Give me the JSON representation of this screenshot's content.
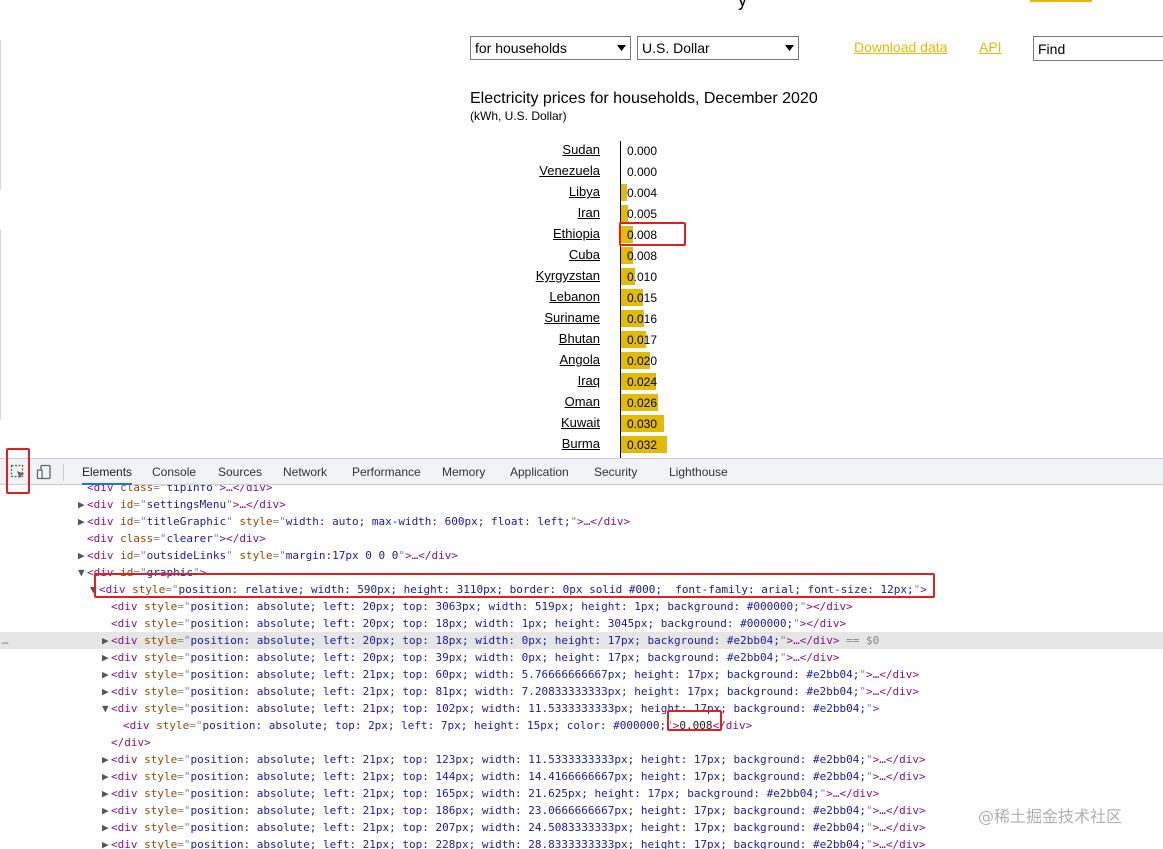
{
  "header": {
    "title_fragment": "y",
    "type_select": "for households",
    "currency_select": "U.S. Dollar",
    "download_link": "Download data",
    "api_link": "API",
    "find_value": "Find"
  },
  "colors": {
    "bar": "#e2bb04",
    "link": "#e2bb04",
    "highlight": "#e02020",
    "devtools_active": "#1a73e8"
  },
  "chart_data": {
    "type": "bar",
    "orientation": "horizontal",
    "title": "Electricity prices for households, December 2020",
    "subtitle": "(kWh, U.S. Dollar)",
    "categories": [
      "Sudan",
      "Venezuela",
      "Libya",
      "Iran",
      "Ethiopia",
      "Cuba",
      "Kyrgyzstan",
      "Lebanon",
      "Suriname",
      "Bhutan",
      "Angola",
      "Iraq",
      "Oman",
      "Kuwait",
      "Burma"
    ],
    "values": [
      0.0,
      0.0,
      0.004,
      0.005,
      0.008,
      0.008,
      0.01,
      0.015,
      0.016,
      0.017,
      0.02,
      0.024,
      0.026,
      0.03,
      0.032
    ],
    "labels": [
      "0.000",
      "0.000",
      "0.004",
      "0.005",
      "0.008",
      "0.008",
      "0.010",
      "0.015",
      "0.016",
      "0.017",
      "0.020",
      "0.024",
      "0.026",
      "0.030",
      "0.032"
    ],
    "highlighted": "Ethiopia"
  },
  "devtools": {
    "tabs": [
      "Elements",
      "Console",
      "Sources",
      "Network",
      "Performance",
      "Memory",
      "Application",
      "Security",
      "Lighthouse"
    ],
    "active_tab": "Elements",
    "selected_suffix": "== $0",
    "lines": [
      {
        "i": 1,
        "tri": "",
        "tag": "div",
        "attrs": [
          [
            "class",
            "tipInfo"
          ]
        ],
        "tail": ">…</div>"
      },
      {
        "i": 1,
        "tri": "▶",
        "tag": "div",
        "attrs": [
          [
            "id",
            "settingsMenu"
          ]
        ],
        "tail": ">…</div>"
      },
      {
        "i": 1,
        "tri": "▶",
        "tag": "div",
        "attrs": [
          [
            "id",
            "titleGraphic"
          ],
          [
            "style",
            "width: auto; max-width: 600px; float: left;"
          ]
        ],
        "tail": ">…</div>"
      },
      {
        "i": 1,
        "tri": "",
        "tag": "div",
        "attrs": [
          [
            "class",
            "clearer"
          ]
        ],
        "tail": "></div>"
      },
      {
        "i": 1,
        "tri": "▶",
        "tag": "div",
        "attrs": [
          [
            "id",
            "outsideLinks"
          ],
          [
            "style",
            "margin:17px 0 0 0"
          ]
        ],
        "tail": ">…</div>"
      },
      {
        "i": 1,
        "tri": "▼",
        "tag": "div",
        "attrs": [
          [
            "id",
            "graphic"
          ]
        ],
        "tail": ">"
      },
      {
        "i": 2,
        "tri": "▼",
        "tag": "div",
        "attrs": [
          [
            "style",
            "position: relative; width: 590px; height: 3110px; border: 0px solid #000;  font-family: arial; font-size: 12px;"
          ]
        ],
        "tail": ">"
      },
      {
        "i": 3,
        "tri": "",
        "tag": "div",
        "attrs": [
          [
            "style",
            "position: absolute; left: 20px; top: 3063px; width: 519px; height: 1px; background: #000000;"
          ]
        ],
        "tail": "></div>"
      },
      {
        "i": 3,
        "tri": "",
        "tag": "div",
        "attrs": [
          [
            "style",
            "position: absolute; left: 20px; top: 18px; width: 1px; height: 3045px; background: #000000;"
          ]
        ],
        "tail": "></div>"
      },
      {
        "i": 3,
        "tri": "▶",
        "tag": "div",
        "attrs": [
          [
            "style",
            "position: absolute; left: 20px; top: 18px; width: 0px; height: 17px; background: #e2bb04;"
          ]
        ],
        "tail": ">…</div>",
        "sel": true
      },
      {
        "i": 3,
        "tri": "▶",
        "tag": "div",
        "attrs": [
          [
            "style",
            "position: absolute; left: 20px; top: 39px; width: 0px; height: 17px; background: #e2bb04;"
          ]
        ],
        "tail": ">…</div>"
      },
      {
        "i": 3,
        "tri": "▶",
        "tag": "div",
        "attrs": [
          [
            "style",
            "position: absolute; left: 21px; top: 60px; width: 5.76666666667px; height: 17px; background: #e2bb04;"
          ]
        ],
        "tail": ">…</div>"
      },
      {
        "i": 3,
        "tri": "▶",
        "tag": "div",
        "attrs": [
          [
            "style",
            "position: absolute; left: 21px; top: 81px; width: 7.20833333333px; height: 17px; background: #e2bb04;"
          ]
        ],
        "tail": ">…</div>"
      },
      {
        "i": 3,
        "tri": "▼",
        "tag": "div",
        "attrs": [
          [
            "style",
            "position: absolute; left: 21px; top: 102px; width: 11.5333333333px; height: 17px; background: #e2bb04;"
          ]
        ],
        "tail": ">"
      },
      {
        "i": 4,
        "tri": "",
        "tag": "div",
        "attrs": [
          [
            "style",
            "position: absolute; top: 2px; left: 7px; height: 15px; color: #000000;"
          ]
        ],
        "tail": ">",
        "text": "0.008",
        "close": "</div>"
      },
      {
        "i": 3,
        "tri": "",
        "tag": "",
        "attrs": [],
        "tail": "",
        "close": "</div>"
      },
      {
        "i": 3,
        "tri": "▶",
        "tag": "div",
        "attrs": [
          [
            "style",
            "position: absolute; left: 21px; top: 123px; width: 11.5333333333px; height: 17px; background: #e2bb04;"
          ]
        ],
        "tail": ">…</div>"
      },
      {
        "i": 3,
        "tri": "▶",
        "tag": "div",
        "attrs": [
          [
            "style",
            "position: absolute; left: 21px; top: 144px; width: 14.4166666667px; height: 17px; background: #e2bb04;"
          ]
        ],
        "tail": ">…</div>"
      },
      {
        "i": 3,
        "tri": "▶",
        "tag": "div",
        "attrs": [
          [
            "style",
            "position: absolute; left: 21px; top: 165px; width: 21.625px; height: 17px; background: #e2bb04;"
          ]
        ],
        "tail": ">…</div>"
      },
      {
        "i": 3,
        "tri": "▶",
        "tag": "div",
        "attrs": [
          [
            "style",
            "position: absolute; left: 21px; top: 186px; width: 23.0666666667px; height: 17px; background: #e2bb04;"
          ]
        ],
        "tail": ">…</div>"
      },
      {
        "i": 3,
        "tri": "▶",
        "tag": "div",
        "attrs": [
          [
            "style",
            "position: absolute; left: 21px; top: 207px; width: 24.5083333333px; height: 17px; background: #e2bb04;"
          ]
        ],
        "tail": ">…</div>"
      },
      {
        "i": 3,
        "tri": "▶",
        "tag": "div",
        "attrs": [
          [
            "style",
            "position: absolute; left: 21px; top: 228px; width: 28.8333333333px; height: 17px; background: #e2bb04;"
          ]
        ],
        "tail": ">…</div>"
      }
    ]
  },
  "watermark": "@稀土掘金技术社区"
}
